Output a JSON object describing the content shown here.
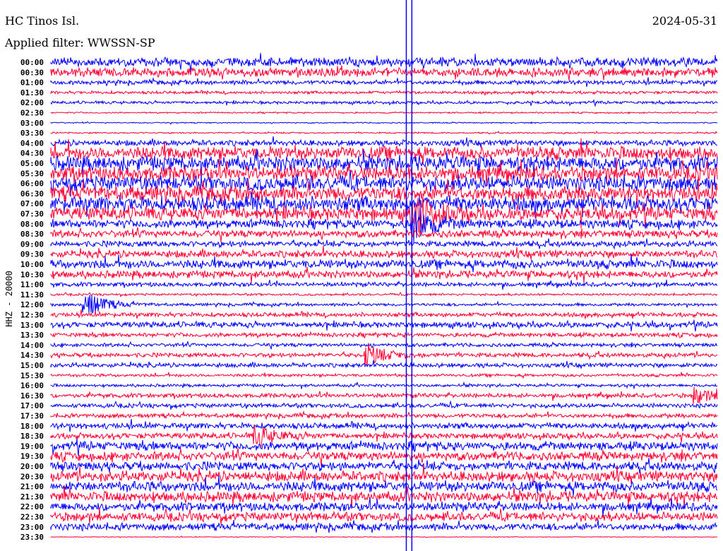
{
  "header": {
    "station": "HC Tinos Isl.",
    "filter": "Applied filter: WWSSN-SP",
    "date": "2024-05-31"
  },
  "chart_data": {
    "type": "line",
    "title": "HC Tinos Isl.",
    "subtitle": "Applied filter: WWSSN-SP",
    "ylabel": "HHZ - 20000",
    "minutes_per_line": 30,
    "colors": [
      "#0000ff",
      "#ff0033"
    ],
    "rows": [
      "00:00",
      "00:30",
      "01:00",
      "01:30",
      "02:00",
      "02:30",
      "03:00",
      "03:30",
      "04:00",
      "04:30",
      "05:00",
      "05:30",
      "06:00",
      "06:30",
      "07:00",
      "07:30",
      "08:00",
      "08:30",
      "09:00",
      "09:30",
      "10:00",
      "10:30",
      "11:00",
      "11:30",
      "12:00",
      "12:30",
      "13:00",
      "13:30",
      "14:00",
      "14:30",
      "15:00",
      "15:30",
      "16:00",
      "16:30",
      "17:00",
      "17:30",
      "18:00",
      "18:30",
      "19:00",
      "19:30",
      "20:00",
      "20:30",
      "21:00",
      "21:30",
      "22:00",
      "22:30",
      "23:00",
      "23:30"
    ],
    "noise_level": [
      0.6,
      0.6,
      0.3,
      0.2,
      0.2,
      0.1,
      0.08,
      0.1,
      0.4,
      0.9,
      1,
      1,
      1,
      1,
      1,
      0.9,
      0.6,
      0.5,
      0.4,
      0.5,
      0.6,
      0.5,
      0.3,
      0.15,
      0.2,
      0.3,
      0.4,
      0.3,
      0.25,
      0.3,
      0.3,
      0.2,
      0.2,
      0.3,
      0.3,
      0.3,
      0.4,
      0.4,
      0.6,
      0.6,
      0.6,
      0.7,
      0.7,
      0.7,
      0.6,
      0.6,
      0.5,
      0.05
    ],
    "events": [
      {
        "row": 15,
        "minute": 16.3,
        "amplitude": 2.5
      },
      {
        "row": 16,
        "minute": 16.3,
        "amplitude": 2.2
      },
      {
        "row": 24,
        "minute": 1.5,
        "amplitude": 1.8
      },
      {
        "row": 29,
        "minute": 14.2,
        "amplitude": 1.3
      },
      {
        "row": 37,
        "minute": 9.2,
        "amplitude": 1.3
      },
      {
        "row": 33,
        "minute": 29.0,
        "amplitude": 0.9
      }
    ],
    "vertical_marks_minute": [
      16.0,
      16.25
    ],
    "last_row_end_minute": 30
  }
}
